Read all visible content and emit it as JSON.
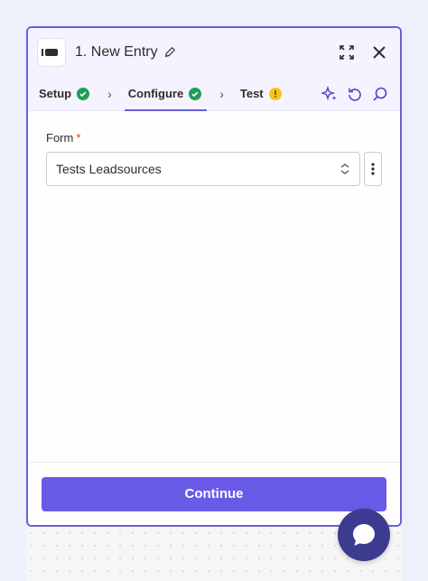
{
  "header": {
    "title": "1. New Entry",
    "app_icon": "app-logo-icon",
    "edit_icon": "pencil-icon",
    "expand_icon": "expand-icon",
    "close_icon": "close-icon"
  },
  "tabs": [
    {
      "label": "Setup",
      "status": "complete"
    },
    {
      "label": "Configure",
      "status": "complete",
      "active": true
    },
    {
      "label": "Test",
      "status": "warning"
    }
  ],
  "tools": [
    "sparkle-icon",
    "refresh-icon",
    "search-icon"
  ],
  "form": {
    "label": "Form",
    "required_marker": "*",
    "selected_value": "Tests Leadsources"
  },
  "footer": {
    "continue_label": "Continue"
  },
  "colors": {
    "accent": "#695be8",
    "success": "#1f9d55",
    "warning": "#f5c518",
    "chat": "#3b3c8f"
  }
}
